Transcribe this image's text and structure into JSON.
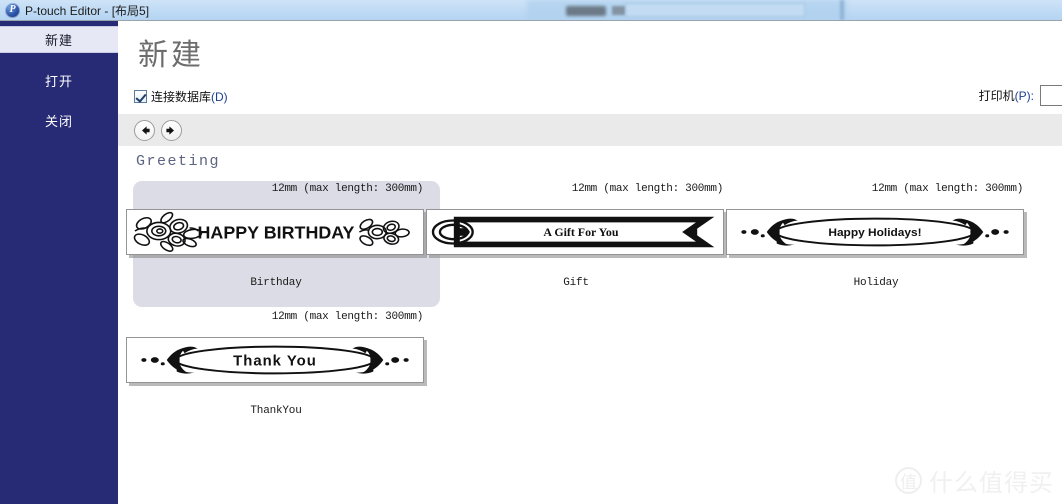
{
  "window": {
    "icon": "ptouch-app-icon",
    "title": "P-touch Editor - [布局5]"
  },
  "sidebar": {
    "items": [
      {
        "label": "新建",
        "active": true
      },
      {
        "label": "打开",
        "active": false
      },
      {
        "label": "关闭",
        "active": false
      }
    ]
  },
  "main": {
    "page_title": "新建",
    "database_checkbox": {
      "label": "连接数据库",
      "accel": "(D)",
      "checked": true
    },
    "printer": {
      "label": "打印机",
      "accel": "(P):",
      "value": ""
    },
    "toolbar": {
      "back_icon": "arrow-left-icon",
      "forward_icon": "arrow-right-icon"
    },
    "category_title": "Greeting",
    "templates": [
      {
        "size": "12mm  (max length: 300mm)",
        "name": "Birthday",
        "art": "HAPPY BIRTHDAY",
        "selected": true
      },
      {
        "size": "12mm (max length: 300mm)",
        "name": "Gift",
        "art": "A Gift For You",
        "selected": false
      },
      {
        "size": "12mm (max length: 300mm)",
        "name": "Holiday",
        "art": "Happy Holidays!",
        "selected": false
      },
      {
        "size": "12mm (max length: 300mm)",
        "name": "ThankYou",
        "art": "Thank You",
        "selected": false
      }
    ]
  },
  "watermark": {
    "logo": "值",
    "text": "什么值得买"
  },
  "colors": {
    "sidebar_bg": "#272a75",
    "sidebar_active_bg": "#e7e8f6",
    "titlebar_bg": "#bcd9f4",
    "toolbar_bg": "#eaeaea",
    "card_selected_bg": "#dcdce6",
    "category_title": "#5b6480",
    "page_title": "#6d6d6d"
  }
}
